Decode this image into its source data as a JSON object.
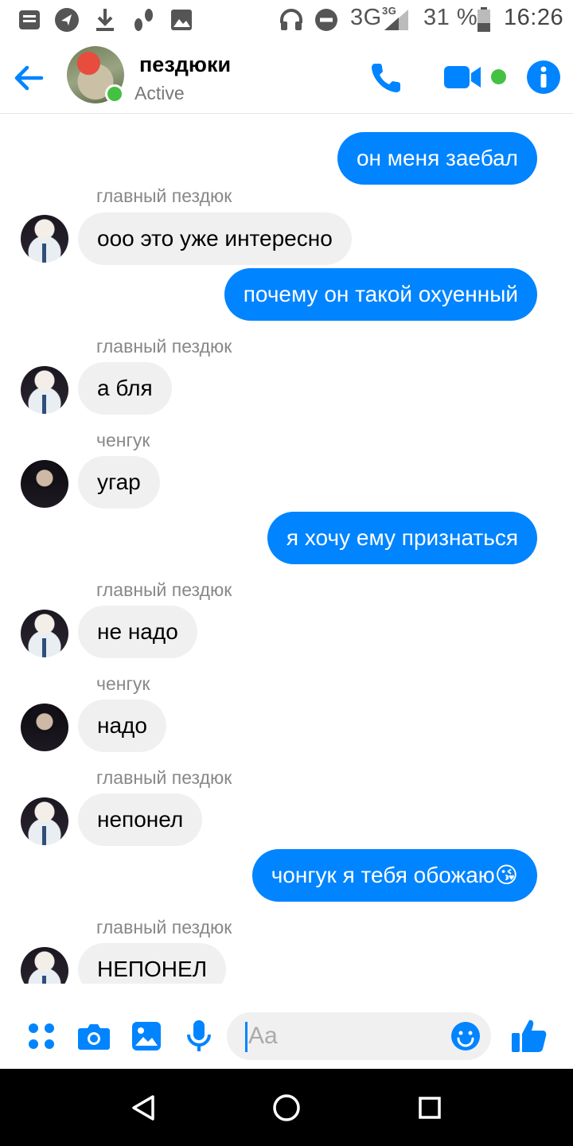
{
  "status_bar": {
    "network": "3G",
    "network_small": "3G",
    "battery": "31 %",
    "time": "16:26",
    "icons": [
      "message-icon",
      "location-icon",
      "download-icon",
      "footprints-icon",
      "image-icon",
      "headphones-icon",
      "do-not-disturb-icon",
      "signal-icon",
      "battery-icon"
    ]
  },
  "header": {
    "title": "пездюки",
    "status": "Active",
    "accent_color": "#0084ff",
    "online_color": "#44c142"
  },
  "messages": [
    {
      "direction": "out",
      "text": "он меня заебал"
    },
    {
      "direction": "in",
      "sender": "главный пездюк",
      "text": "ооо это уже интересно"
    },
    {
      "direction": "out",
      "text": "почему он такой охуенный"
    },
    {
      "direction": "in",
      "sender": "главный пездюк",
      "text": "а бля"
    },
    {
      "direction": "in",
      "sender": "ченгук",
      "text": "угар"
    },
    {
      "direction": "out",
      "text": "я хочу ему признаться"
    },
    {
      "direction": "in",
      "sender": "главный пездюк",
      "text": "не надо"
    },
    {
      "direction": "in",
      "sender": "ченгук",
      "text": "надо"
    },
    {
      "direction": "in",
      "sender": "главный пездюк",
      "text": "непонел"
    },
    {
      "direction": "out",
      "text": "чонгук я тебя обожаю😘"
    },
    {
      "direction": "in",
      "sender": "главный пездюк",
      "text": "НЕПОНЕЛ"
    }
  ],
  "composer": {
    "placeholder": "Aa",
    "buttons": [
      "menu-icon",
      "camera-icon",
      "gallery-icon",
      "microphone-icon",
      "emoji-icon",
      "thumbs-up-icon"
    ]
  },
  "nav": {
    "buttons": [
      "back-triangle-icon",
      "home-circle-icon",
      "recents-square-icon"
    ]
  }
}
